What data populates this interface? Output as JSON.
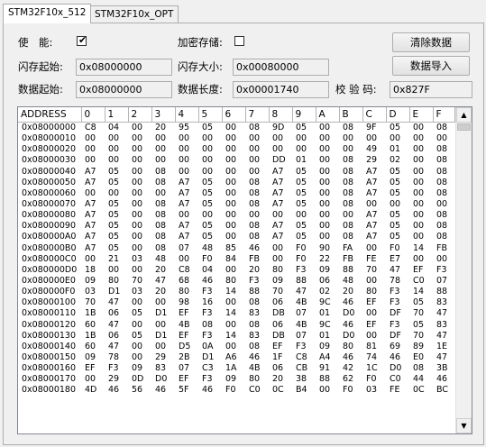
{
  "tabs": [
    {
      "label": "STM32F10x_512",
      "active": true
    },
    {
      "label": "STM32F10x_OPT",
      "active": false
    }
  ],
  "form": {
    "enable_label": "使　能:",
    "enable_checked": true,
    "encrypt_label": "加密存储:",
    "encrypt_checked": false,
    "flash_start_label": "闪存起始:",
    "flash_start_value": "0x08000000",
    "flash_size_label": "闪存大小:",
    "flash_size_value": "0x00080000",
    "data_start_label": "数据起始:",
    "data_start_value": "0x08000000",
    "data_len_label": "数据长度:",
    "data_len_value": "0x00001740",
    "checksum_label": "校 验 码:",
    "checksum_value": "0x827F",
    "clear_button": "清除数据",
    "import_button": "数据导入"
  },
  "grid": {
    "headers": [
      "ADDRESS",
      "0",
      "1",
      "2",
      "3",
      "4",
      "5",
      "6",
      "7",
      "8",
      "9",
      "A",
      "B",
      "C",
      "D",
      "E",
      "F"
    ],
    "rows": [
      [
        "0x08000000",
        "C8",
        "04",
        "00",
        "20",
        "95",
        "05",
        "00",
        "08",
        "9D",
        "05",
        "00",
        "08",
        "9F",
        "05",
        "00",
        "08"
      ],
      [
        "0x08000010",
        "00",
        "00",
        "00",
        "00",
        "00",
        "00",
        "00",
        "00",
        "00",
        "00",
        "00",
        "00",
        "00",
        "00",
        "00",
        "00"
      ],
      [
        "0x08000020",
        "00",
        "00",
        "00",
        "00",
        "00",
        "00",
        "00",
        "00",
        "00",
        "00",
        "00",
        "00",
        "49",
        "01",
        "00",
        "08"
      ],
      [
        "0x08000030",
        "00",
        "00",
        "00",
        "00",
        "00",
        "00",
        "00",
        "00",
        "DD",
        "01",
        "00",
        "08",
        "29",
        "02",
        "00",
        "08"
      ],
      [
        "0x08000040",
        "A7",
        "05",
        "00",
        "08",
        "00",
        "00",
        "00",
        "00",
        "A7",
        "05",
        "00",
        "08",
        "A7",
        "05",
        "00",
        "08"
      ],
      [
        "0x08000050",
        "A7",
        "05",
        "00",
        "08",
        "A7",
        "05",
        "00",
        "08",
        "A7",
        "05",
        "00",
        "08",
        "A7",
        "05",
        "00",
        "08"
      ],
      [
        "0x08000060",
        "00",
        "00",
        "00",
        "00",
        "A7",
        "05",
        "00",
        "08",
        "A7",
        "05",
        "00",
        "08",
        "A7",
        "05",
        "00",
        "08"
      ],
      [
        "0x08000070",
        "A7",
        "05",
        "00",
        "08",
        "A7",
        "05",
        "00",
        "08",
        "A7",
        "05",
        "00",
        "08",
        "00",
        "00",
        "00",
        "00"
      ],
      [
        "0x08000080",
        "A7",
        "05",
        "00",
        "08",
        "00",
        "00",
        "00",
        "00",
        "00",
        "00",
        "00",
        "00",
        "A7",
        "05",
        "00",
        "08"
      ],
      [
        "0x08000090",
        "A7",
        "05",
        "00",
        "08",
        "A7",
        "05",
        "00",
        "08",
        "A7",
        "05",
        "00",
        "08",
        "A7",
        "05",
        "00",
        "08"
      ],
      [
        "0x080000A0",
        "A7",
        "05",
        "00",
        "08",
        "A7",
        "05",
        "00",
        "08",
        "A7",
        "05",
        "00",
        "08",
        "A7",
        "05",
        "00",
        "08"
      ],
      [
        "0x080000B0",
        "A7",
        "05",
        "00",
        "08",
        "07",
        "48",
        "85",
        "46",
        "00",
        "F0",
        "90",
        "FA",
        "00",
        "F0",
        "14",
        "FB"
      ],
      [
        "0x080000C0",
        "00",
        "21",
        "03",
        "48",
        "00",
        "F0",
        "84",
        "FB",
        "00",
        "F0",
        "22",
        "FB",
        "FE",
        "E7",
        "00",
        "00"
      ],
      [
        "0x080000D0",
        "18",
        "00",
        "00",
        "20",
        "C8",
        "04",
        "00",
        "20",
        "80",
        "F3",
        "09",
        "88",
        "70",
        "47",
        "EF",
        "F3"
      ],
      [
        "0x080000E0",
        "09",
        "80",
        "70",
        "47",
        "68",
        "46",
        "80",
        "F3",
        "09",
        "88",
        "06",
        "48",
        "00",
        "78",
        "C0",
        "07"
      ],
      [
        "0x080000F0",
        "03",
        "D1",
        "03",
        "20",
        "80",
        "F3",
        "14",
        "88",
        "70",
        "47",
        "02",
        "20",
        "80",
        "F3",
        "14",
        "88"
      ],
      [
        "0x08000100",
        "70",
        "47",
        "00",
        "00",
        "98",
        "16",
        "00",
        "08",
        "06",
        "4B",
        "9C",
        "46",
        "EF",
        "F3",
        "05",
        "83"
      ],
      [
        "0x08000110",
        "1B",
        "06",
        "05",
        "D1",
        "EF",
        "F3",
        "14",
        "83",
        "DB",
        "07",
        "01",
        "D0",
        "00",
        "DF",
        "70",
        "47"
      ],
      [
        "0x08000120",
        "60",
        "47",
        "00",
        "00",
        "4B",
        "08",
        "00",
        "08",
        "06",
        "4B",
        "9C",
        "46",
        "EF",
        "F3",
        "05",
        "83"
      ],
      [
        "0x08000130",
        "1B",
        "06",
        "05",
        "D1",
        "EF",
        "F3",
        "14",
        "83",
        "DB",
        "07",
        "01",
        "D0",
        "00",
        "DF",
        "70",
        "47"
      ],
      [
        "0x08000140",
        "60",
        "47",
        "00",
        "00",
        "D5",
        "0A",
        "00",
        "08",
        "EF",
        "F3",
        "09",
        "80",
        "81",
        "69",
        "89",
        "1E"
      ],
      [
        "0x08000150",
        "09",
        "78",
        "00",
        "29",
        "2B",
        "D1",
        "A6",
        "46",
        "1F",
        "C8",
        "A4",
        "46",
        "74",
        "46",
        "E0",
        "47"
      ],
      [
        "0x08000160",
        "EF",
        "F3",
        "09",
        "83",
        "07",
        "C3",
        "1A",
        "4B",
        "06",
        "CB",
        "91",
        "42",
        "1C",
        "D0",
        "08",
        "3B"
      ],
      [
        "0x08000170",
        "00",
        "29",
        "0D",
        "D0",
        "EF",
        "F3",
        "09",
        "80",
        "20",
        "38",
        "88",
        "62",
        "F0",
        "C0",
        "44",
        "46"
      ],
      [
        "0x08000180",
        "4D",
        "46",
        "56",
        "46",
        "5F",
        "46",
        "F0",
        "C0",
        "0C",
        "B4",
        "00",
        "F0",
        "03",
        "FE",
        "0C",
        "BC"
      ]
    ]
  }
}
